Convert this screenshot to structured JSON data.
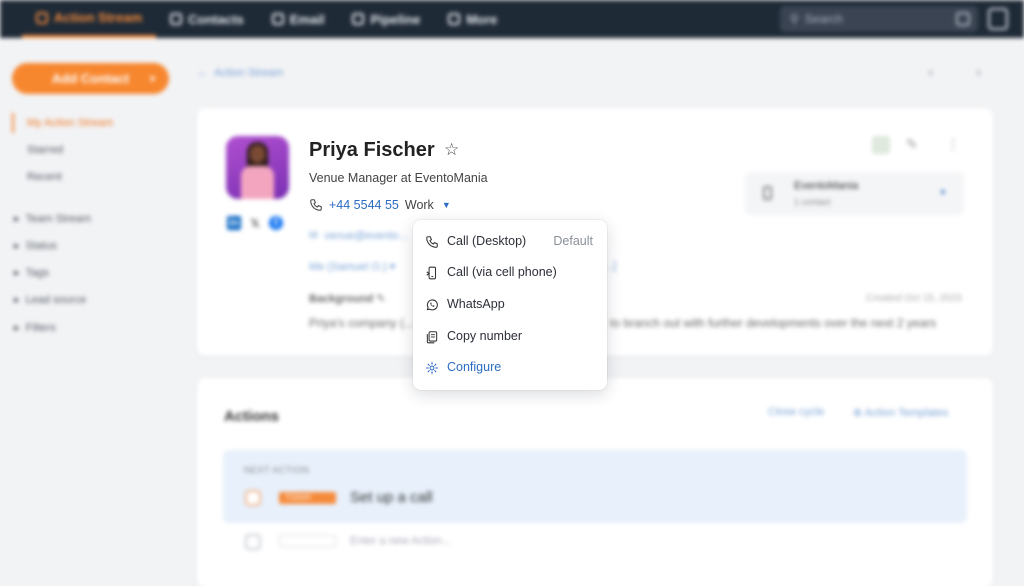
{
  "nav": {
    "items": [
      "Action Stream",
      "Contacts",
      "Email",
      "Pipeline",
      "More"
    ],
    "search_placeholder": "Search"
  },
  "sidebar": {
    "add_contact": "Add Contact",
    "links": [
      "My Action Stream",
      "Starred",
      "Recent"
    ],
    "groups": [
      "Team Stream",
      "Status",
      "Tags",
      "Lead source",
      "Filters"
    ]
  },
  "breadcrumb": "Action Stream",
  "contact": {
    "name": "Priya Fischer",
    "role": "Venue Manager at EventoMania",
    "phone": "+44 5544 55",
    "phone_type": "Work",
    "email": "venue@evento...",
    "owner": "Me (Samuel O.)",
    "owner_tail": "...]",
    "background_label": "Background",
    "created": "Created Oct 15, 2023",
    "background_text_left": "Priya's company (...",
    "background_text_right": "to branch out with further developments over the next 2 years"
  },
  "company": {
    "name": "EventoMania",
    "sub": "1 contact"
  },
  "phone_menu": {
    "items": [
      {
        "icon": "phone-icon",
        "label": "Call (Desktop)",
        "hint": "Default"
      },
      {
        "icon": "cell-phone-icon",
        "label": "Call (via cell phone)",
        "hint": ""
      },
      {
        "icon": "whatsapp-icon",
        "label": "WhatsApp",
        "hint": ""
      },
      {
        "icon": "copy-icon",
        "label": "Copy number",
        "hint": ""
      },
      {
        "icon": "gear-icon",
        "label": "Configure",
        "hint": ""
      }
    ]
  },
  "actions": {
    "title": "Actions",
    "close_cycle": "Close cycle",
    "templates": "Action Templates",
    "next_label": "NEXT ACTION",
    "today_tag": "TODAY",
    "task": "Set up a call",
    "new_placeholder": "Enter a new Action..."
  },
  "colors": {
    "accent": "#f58a3a",
    "link": "#2b6cc4",
    "topbar": "#1f2a37"
  }
}
